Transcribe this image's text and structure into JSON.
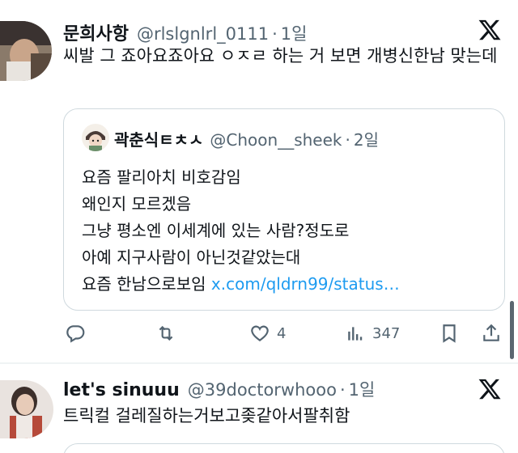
{
  "post1": {
    "author_name": "문희사항",
    "author_handle": "@rlslgnlrl_0111",
    "separator": "·",
    "time": "1일",
    "text": "씨발 그 죠아요죠아요 ㅇㅈㄹ 하는 거 보면 개병신한남 맞는데",
    "quote": {
      "author_name": "곽춘식ㅌㅊㅅ",
      "author_handle": "@Choon__sheek",
      "separator": "·",
      "time": "2일",
      "lines": [
        "요즘 팔리아치 비호감임",
        "왜인지 모르겠음",
        "그냥 평소엔 이세계에 있는 사람?정도로",
        "아예 지구사람이 아닌것같았는대"
      ],
      "last_line_text": "요즘 한남으로보임 ",
      "last_line_link": "x.com/qldrn99/status…"
    },
    "actions": {
      "reply": "",
      "repost": "",
      "like_count": "4",
      "views_count": "347"
    }
  },
  "post2": {
    "author_name": "let's sinuuu",
    "author_handle": "@39doctorwhooo",
    "separator": "·",
    "time": "1일",
    "text": "트릭컬 걸레질하는거보고좆같아서팔취함"
  },
  "icons": {
    "logo": "x-logo-icon",
    "reply": "reply-icon",
    "repost": "repost-icon",
    "like": "heart-icon",
    "views": "views-icon",
    "bookmark": "bookmark-icon",
    "share": "share-icon"
  },
  "colors": {
    "text": "#0f1419",
    "secondary": "#536471",
    "link": "#1d9bf0",
    "border": "#cfd9de"
  }
}
